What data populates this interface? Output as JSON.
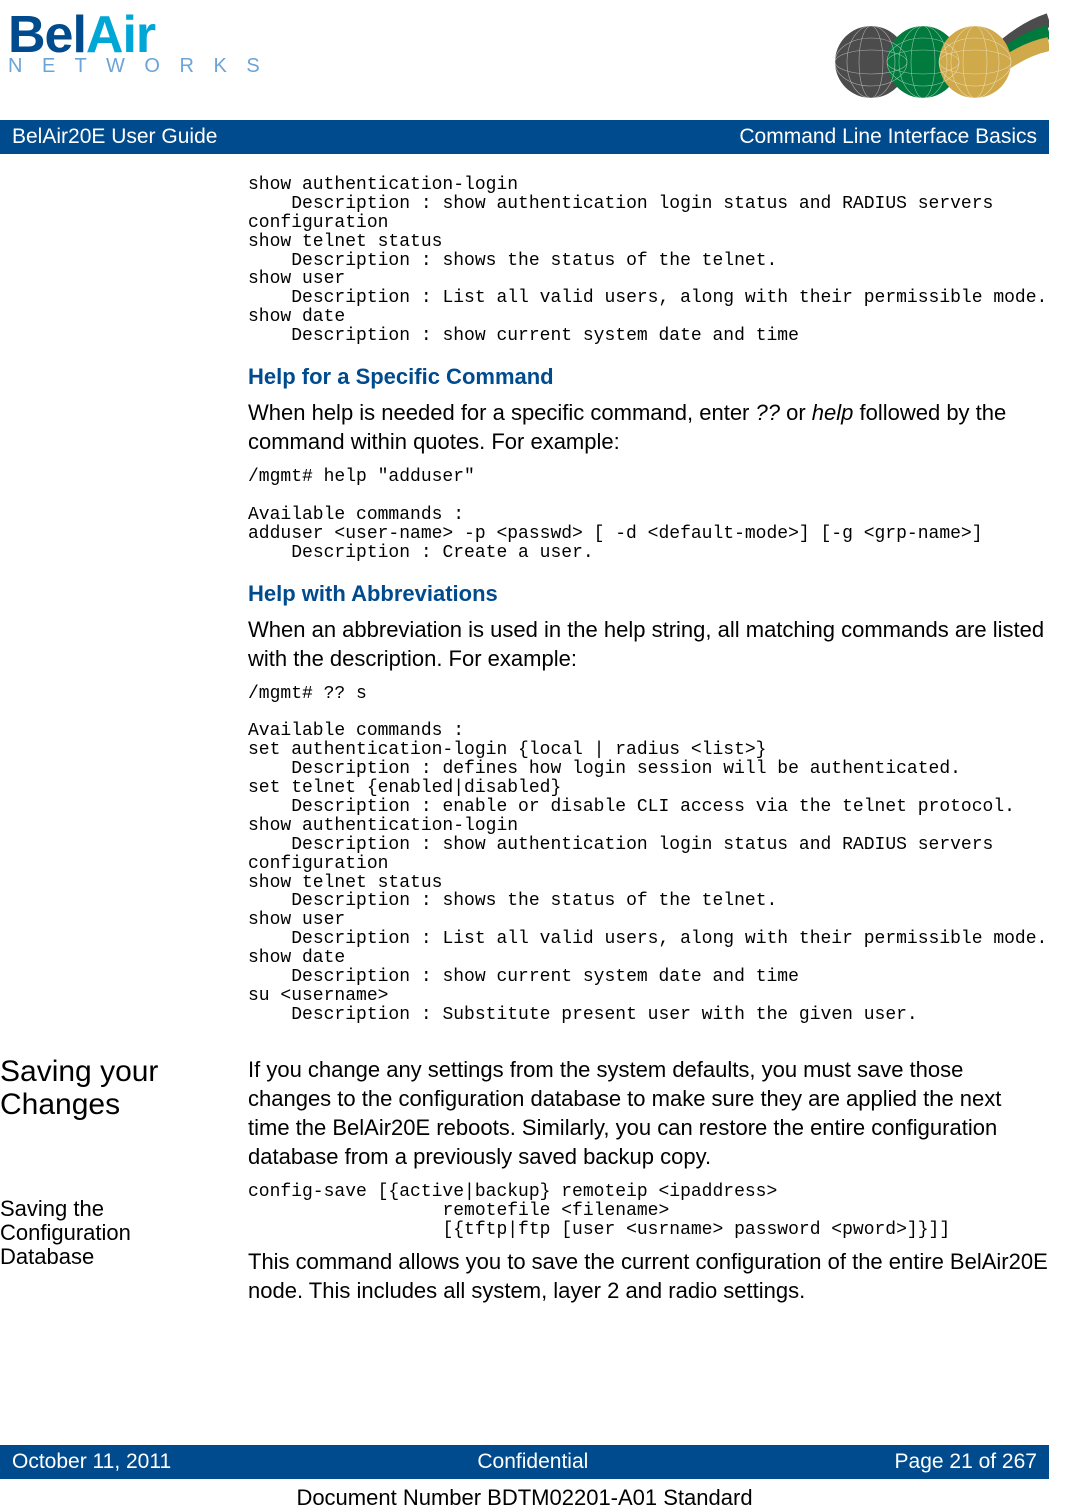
{
  "logo": {
    "bel": "Bel",
    "air": "Air",
    "networks": "N E T W O R K S"
  },
  "header_bar": {
    "left": "BelAir20E User Guide",
    "right": "Command Line Interface Basics"
  },
  "code1": "show authentication-login\n    Description : show authentication login status and RADIUS servers \nconfiguration\nshow telnet status\n    Description : shows the status of the telnet.\nshow user\n    Description : List all valid users, along with their permissible mode.\nshow date\n    Description : show current system date and time",
  "sec1": {
    "heading": "Help for a Specific Command",
    "para_a": "When help is needed for a specific command, enter ",
    "qq": "??",
    "para_b": " or ",
    "help": "help",
    "para_c": " followed by the command within quotes. For example:"
  },
  "code2": "/mgmt# help \"adduser\"\n\nAvailable commands :\nadduser <user-name> -p <passwd> [ -d <default-mode>] [-g <grp-name>]\n    Description : Create a user.",
  "sec2": {
    "heading": "Help with Abbreviations",
    "para": "When an abbreviation is used in the help string, all matching commands are listed with the description. For example:"
  },
  "code3": "/mgmt# ?? s\n\nAvailable commands :\nset authentication-login {local | radius <list>}\n    Description : defines how login session will be authenticated.\nset telnet {enabled|disabled}\n    Description : enable or disable CLI access via the telnet protocol.\nshow authentication-login\n    Description : show authentication login status and RADIUS servers \nconfiguration\nshow telnet status\n    Description : shows the status of the telnet.\nshow user\n    Description : List all valid users, along with their permissible mode.\nshow date\n    Description : show current system date and time\nsu <username>\n    Description : Substitute present user with the given user.",
  "saving": {
    "side1": "Saving your Changes",
    "para1": "If you change any settings from the system defaults, you must save those changes to the configuration database to make sure they are applied the next time the BelAir20E reboots. Similarly, you can restore the entire configuration database from a previously saved backup copy.",
    "side2": "Saving the Configuration Database",
    "code": "config-save [{active|backup} remoteip <ipaddress> \n                  remotefile <filename> \n                  [{tftp|ftp [user <usrname> password <pword>]}]]",
    "para2": "This command allows you to save the current configuration of the entire BelAir20E node. This includes all system, layer 2 and radio settings."
  },
  "footer": {
    "left": "October 11, 2011",
    "center": "Confidential",
    "right": "Page 21 of 267",
    "docnum": "Document Number BDTM02201-A01 Standard"
  }
}
